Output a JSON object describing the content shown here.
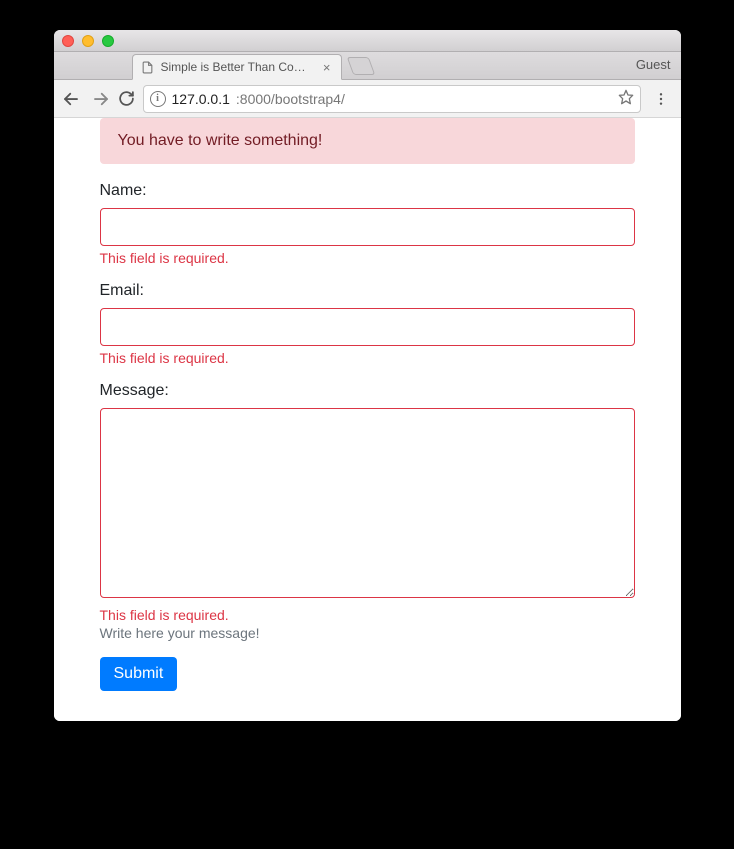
{
  "window": {
    "guest_label": "Guest"
  },
  "tab": {
    "title": "Simple is Better Than Complex"
  },
  "address": {
    "host": "127.0.0.1",
    "port_path": ":8000/bootstrap4/"
  },
  "alert": {
    "message": "You have to write something!"
  },
  "form": {
    "name": {
      "label": "Name:",
      "value": "",
      "error": "This field is required."
    },
    "email": {
      "label": "Email:",
      "value": "",
      "error": "This field is required."
    },
    "message": {
      "label": "Message:",
      "value": "",
      "error": "This field is required.",
      "help": "Write here your message!"
    },
    "submit_label": "Submit"
  }
}
